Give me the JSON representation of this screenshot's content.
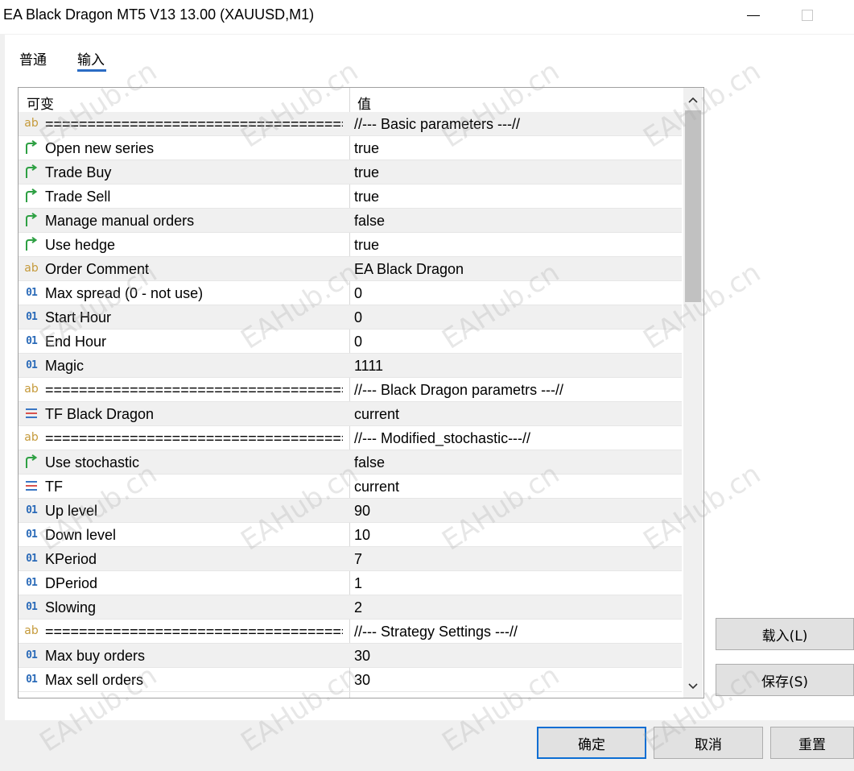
{
  "window": {
    "title": "EA Black Dragon MT5 V13 13.00 (XAUUSD,M1)"
  },
  "tabs": [
    {
      "label": "普通",
      "active": false
    },
    {
      "label": "输入",
      "active": true
    }
  ],
  "grid": {
    "columns": {
      "variable": "可变",
      "value": "值"
    },
    "rows": [
      {
        "icon": "ab",
        "name": "==============================================",
        "value": "//--- Basic parameters ---//"
      },
      {
        "icon": "arrow",
        "name": "Open new series",
        "value": "true"
      },
      {
        "icon": "arrow",
        "name": "Trade Buy",
        "value": "true"
      },
      {
        "icon": "arrow",
        "name": "Trade Sell",
        "value": "true"
      },
      {
        "icon": "arrow",
        "name": "Manage manual orders",
        "value": "false"
      },
      {
        "icon": "arrow",
        "name": "Use hedge",
        "value": "true"
      },
      {
        "icon": "ab",
        "name": "Order Comment",
        "value": "EA Black Dragon"
      },
      {
        "icon": "01",
        "name": "Max spread (0 - not use)",
        "value": "0"
      },
      {
        "icon": "01",
        "name": "Start Hour",
        "value": "0"
      },
      {
        "icon": "01",
        "name": "End Hour",
        "value": "0"
      },
      {
        "icon": "01",
        "name": "Magic",
        "value": "1111"
      },
      {
        "icon": "ab",
        "name": "==============================================",
        "value": "//--- Black Dragon parametrs ---//"
      },
      {
        "icon": "enum",
        "name": "TF Black Dragon",
        "value": "current"
      },
      {
        "icon": "ab",
        "name": "==============================================",
        "value": "//--- Modified_stochastic---//"
      },
      {
        "icon": "arrow",
        "name": "Use stochastic",
        "value": "false"
      },
      {
        "icon": "enum",
        "name": "TF",
        "value": "current"
      },
      {
        "icon": "01",
        "name": "Up level",
        "value": "90"
      },
      {
        "icon": "01",
        "name": "Down level",
        "value": "10"
      },
      {
        "icon": "01",
        "name": "KPeriod",
        "value": "7"
      },
      {
        "icon": "01",
        "name": "DPeriod",
        "value": "1"
      },
      {
        "icon": "01",
        "name": "Slowing",
        "value": "2"
      },
      {
        "icon": "ab",
        "name": "==============================================",
        "value": "//--- Strategy Settings ---//"
      },
      {
        "icon": "01",
        "name": "Max buy orders",
        "value": "30"
      },
      {
        "icon": "01",
        "name": "Max sell orders",
        "value": "30"
      }
    ]
  },
  "buttons": {
    "load": "载入(L)",
    "save": "保存(S)",
    "ok": "确定",
    "cancel": "取消",
    "reset": "重置"
  },
  "watermark": "EAHub.cn",
  "colors": {
    "accent": "#2b6cc4",
    "ok_border": "#0b6ed3",
    "bool_icon": "#2ea043",
    "int_icon": "#2a6ab8",
    "string_icon": "#c59a3a",
    "enum_icon_red": "#d9534f",
    "enum_icon_blue": "#3a76c4"
  }
}
